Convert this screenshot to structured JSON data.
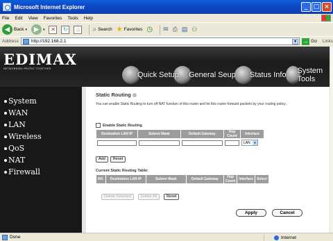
{
  "window": {
    "title": "Microsoft Internet Explorer"
  },
  "menu": [
    "File",
    "Edit",
    "View",
    "Favorites",
    "Tools",
    "Help"
  ],
  "toolbar": {
    "back": "Back",
    "search": "Search",
    "favorites": "Favorites"
  },
  "address": {
    "label": "Address",
    "url": "http://192.168.2.1",
    "go": "Go",
    "links": "Links"
  },
  "header": {
    "brand": "EDIMAX",
    "tagline": "NETWORKING PEOPLE TOGETHER",
    "tabs": [
      "Quick Setup",
      "General Seup",
      "Status Info",
      "System Tools"
    ]
  },
  "sidebar": {
    "items": [
      "System",
      "WAN",
      "LAN",
      "Wireless",
      "QoS",
      "NAT",
      "Firewall"
    ]
  },
  "content": {
    "title": "Static Routing",
    "description": "You can enable Static Routing to turn off NAT function of this router and let this router forward packets by your routing policy.",
    "enable_label": "Enable Static Routing",
    "columns": [
      "Destination LAN IP",
      "Subnet Mask",
      "Default Gateway",
      "Hop Count",
      "Interface"
    ],
    "interface_value": "LAN",
    "add": "Add",
    "reset": "Reset",
    "current_title": "Current Static Routing Table:",
    "current_columns": [
      "NO.",
      "Destination LAN IP",
      "Subnet Mask",
      "Default Gateway",
      "Hop Count",
      "Interface",
      "Select"
    ],
    "delete_selected": "Delete Selected",
    "delete_all": "Delete All",
    "reset2": "Reset",
    "apply": "Apply",
    "cancel": "Cancel"
  },
  "status": {
    "left": "Done",
    "right": "Internet"
  }
}
